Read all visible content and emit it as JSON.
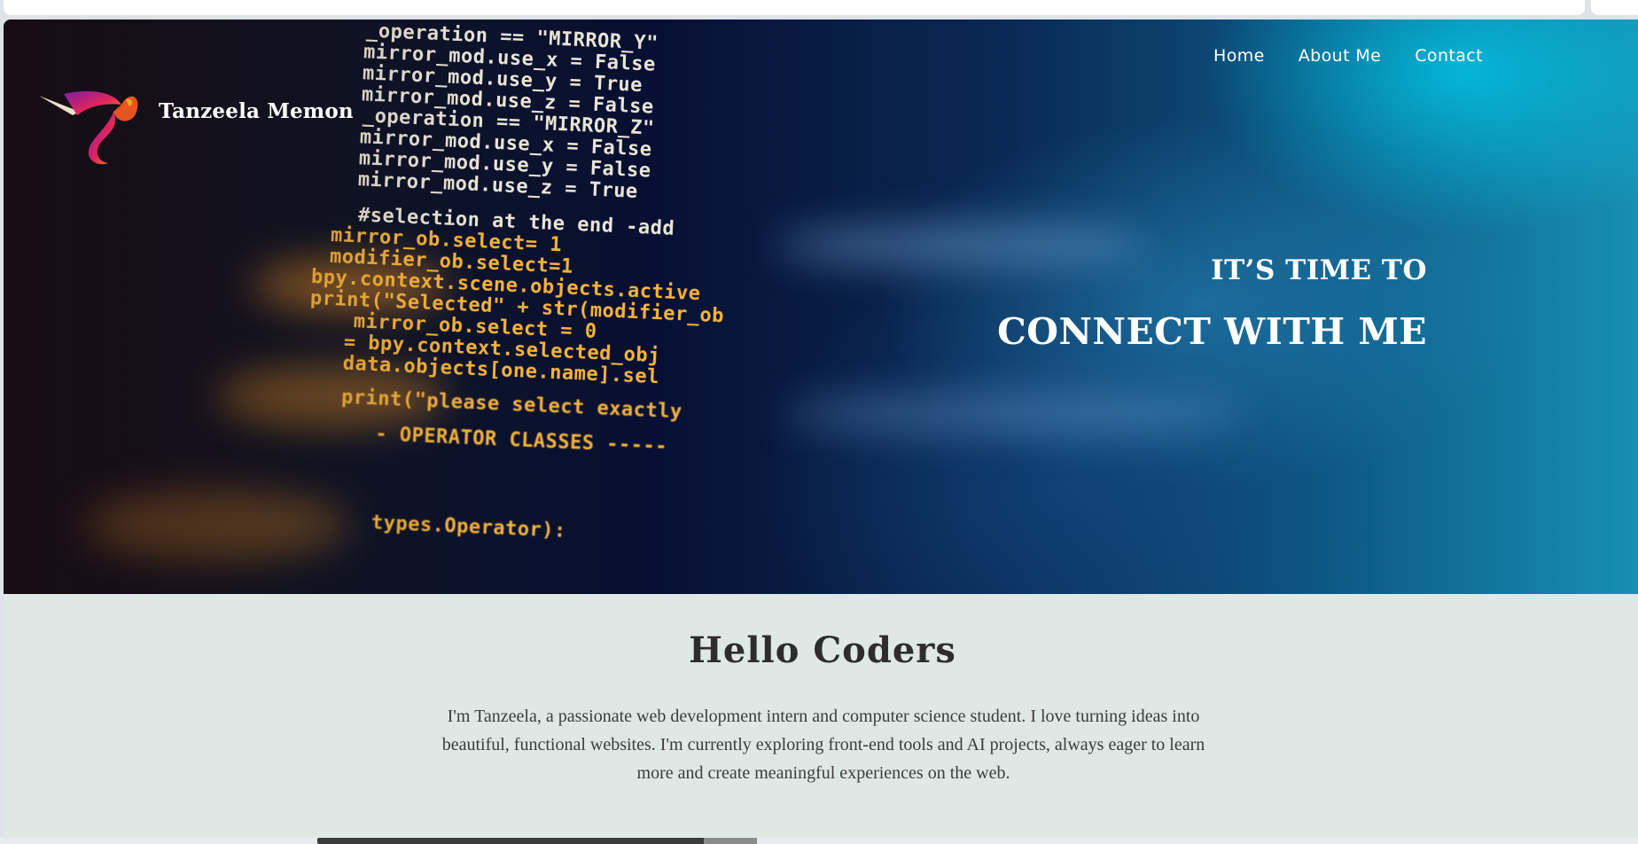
{
  "site": {
    "brand": "Tanzeela Memon",
    "logo_icon": "hummingbird-logo-icon"
  },
  "nav": {
    "items": [
      {
        "label": "Home"
      },
      {
        "label": "About Me"
      },
      {
        "label": "Contact"
      }
    ]
  },
  "hero": {
    "tagline_small": "IT’S TIME TO",
    "tagline_large": "CONNECT WITH ME",
    "code_lines": [
      {
        "text": "_operation == \"MIRROR_Y\"",
        "tone": "white"
      },
      {
        "text": "mirror_mod.use_x = False",
        "tone": "white"
      },
      {
        "text": "mirror_mod.use_y = True",
        "tone": "white"
      },
      {
        "text": "mirror_mod.use_z = False",
        "tone": "white"
      },
      {
        "text": "_operation == \"MIRROR_Z\"",
        "tone": "white"
      },
      {
        "text": "mirror_mod.use_x = False",
        "tone": "white"
      },
      {
        "text": "mirror_mod.use_y = False",
        "tone": "white"
      },
      {
        "text": "mirror_mod.use_z = True",
        "tone": "white"
      },
      {
        "text": "#selection at the end -add",
        "tone": "white"
      },
      {
        "text": "mirror_ob.select= 1",
        "tone": "orange"
      },
      {
        "text": "modifier_ob.select=1",
        "tone": "orange"
      },
      {
        "text": "bpy.context.scene.objects.active",
        "tone": "orange"
      },
      {
        "text": "print(\"Selected\" + str(modifier_ob",
        "tone": "orange"
      },
      {
        "text": "mirror_ob.select = 0",
        "tone": "orange"
      },
      {
        "text": "= bpy.context.selected_obj",
        "tone": "orange"
      },
      {
        "text": "data.objects[one.name].sel",
        "tone": "orange"
      },
      {
        "text": "print(\"please select exactly",
        "tone": "orange"
      },
      {
        "text": "- OPERATOR CLASSES -----",
        "tone": "orange"
      },
      {
        "text": "types.Operator):",
        "tone": "orange"
      }
    ]
  },
  "about": {
    "title": "Hello Coders",
    "text": "I'm Tanzeela, a passionate web development intern and computer science student. I love turning ideas into beautiful, functional websites. I'm currently exploring front-end tools and AI projects, always eager to learn more and create meaningful experiences on the web."
  },
  "colors": {
    "about_bg": "#dfe8e4",
    "hero_accent_cyan": "#00cdeb",
    "code_orange": "#f7b43a",
    "text_dark": "#2d2d2d"
  }
}
